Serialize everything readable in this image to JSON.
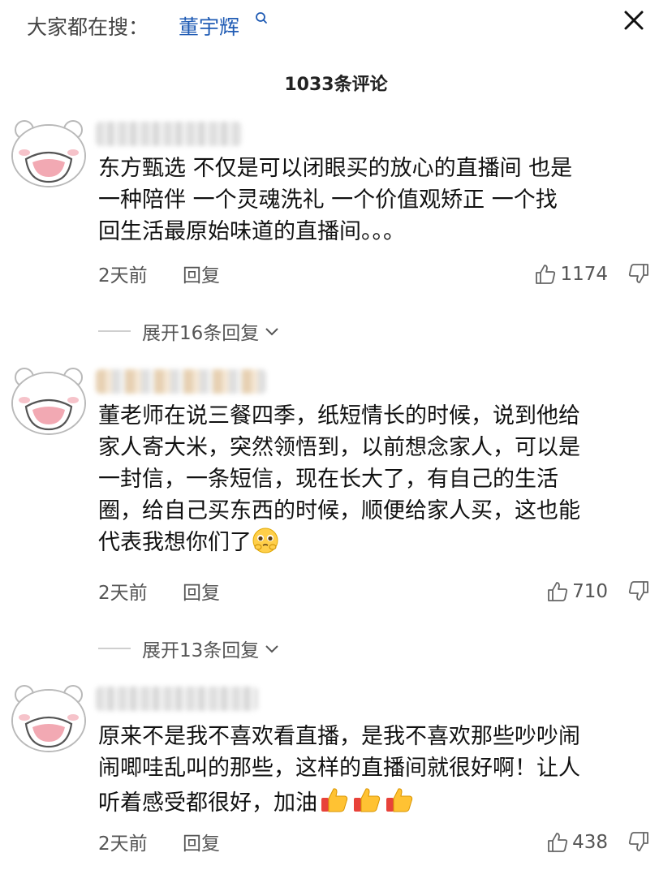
{
  "search": {
    "prefix": "大家都在搜：",
    "term": "董宇辉",
    "icon": "search-icon"
  },
  "close_icon": "close-icon",
  "title": "1033条评论",
  "colors": {
    "link": "#1f5bb4",
    "meta": "#555555",
    "text": "#111111",
    "avatar_pink": "#f2a9b3"
  },
  "comments": [
    {
      "text_lines": [
        "东方甄选  不仅是可以闭眼买的放心的直播间  也是",
        "一种陪伴  一个灵魂洗礼  一个价值观矫正  一个找",
        "回生活最原始味道的直播间。。。"
      ],
      "time": "2天前",
      "reply_label": "回复",
      "likes": "1174",
      "expand_label": "展开16条回复"
    },
    {
      "text_lines": [
        "董老师在说三餐四季，纸短情长的时候，说到他给",
        "家人寄大米，突然领悟到，以前想念家人，可以是",
        "一封信，一条短信，现在长大了，有自己的生活",
        "圈，给自己买东西的时候，顺便给家人买，这也能",
        "代表我想你们了"
      ],
      "emoji": "pleading-face-emoji",
      "time": "2天前",
      "reply_label": "回复",
      "likes": "710",
      "expand_label": "展开13条回复"
    },
    {
      "text_lines": [
        "原来不是我不喜欢看直播，是我不喜欢那些吵吵闹",
        "闹唧哇乱叫的那些，这样的直播间就很好啊！让人",
        "听着感受都很好，加油"
      ],
      "emoji": "thumbs-up-emoji",
      "time": "2天前",
      "reply_label": "回复",
      "likes": "438"
    }
  ]
}
